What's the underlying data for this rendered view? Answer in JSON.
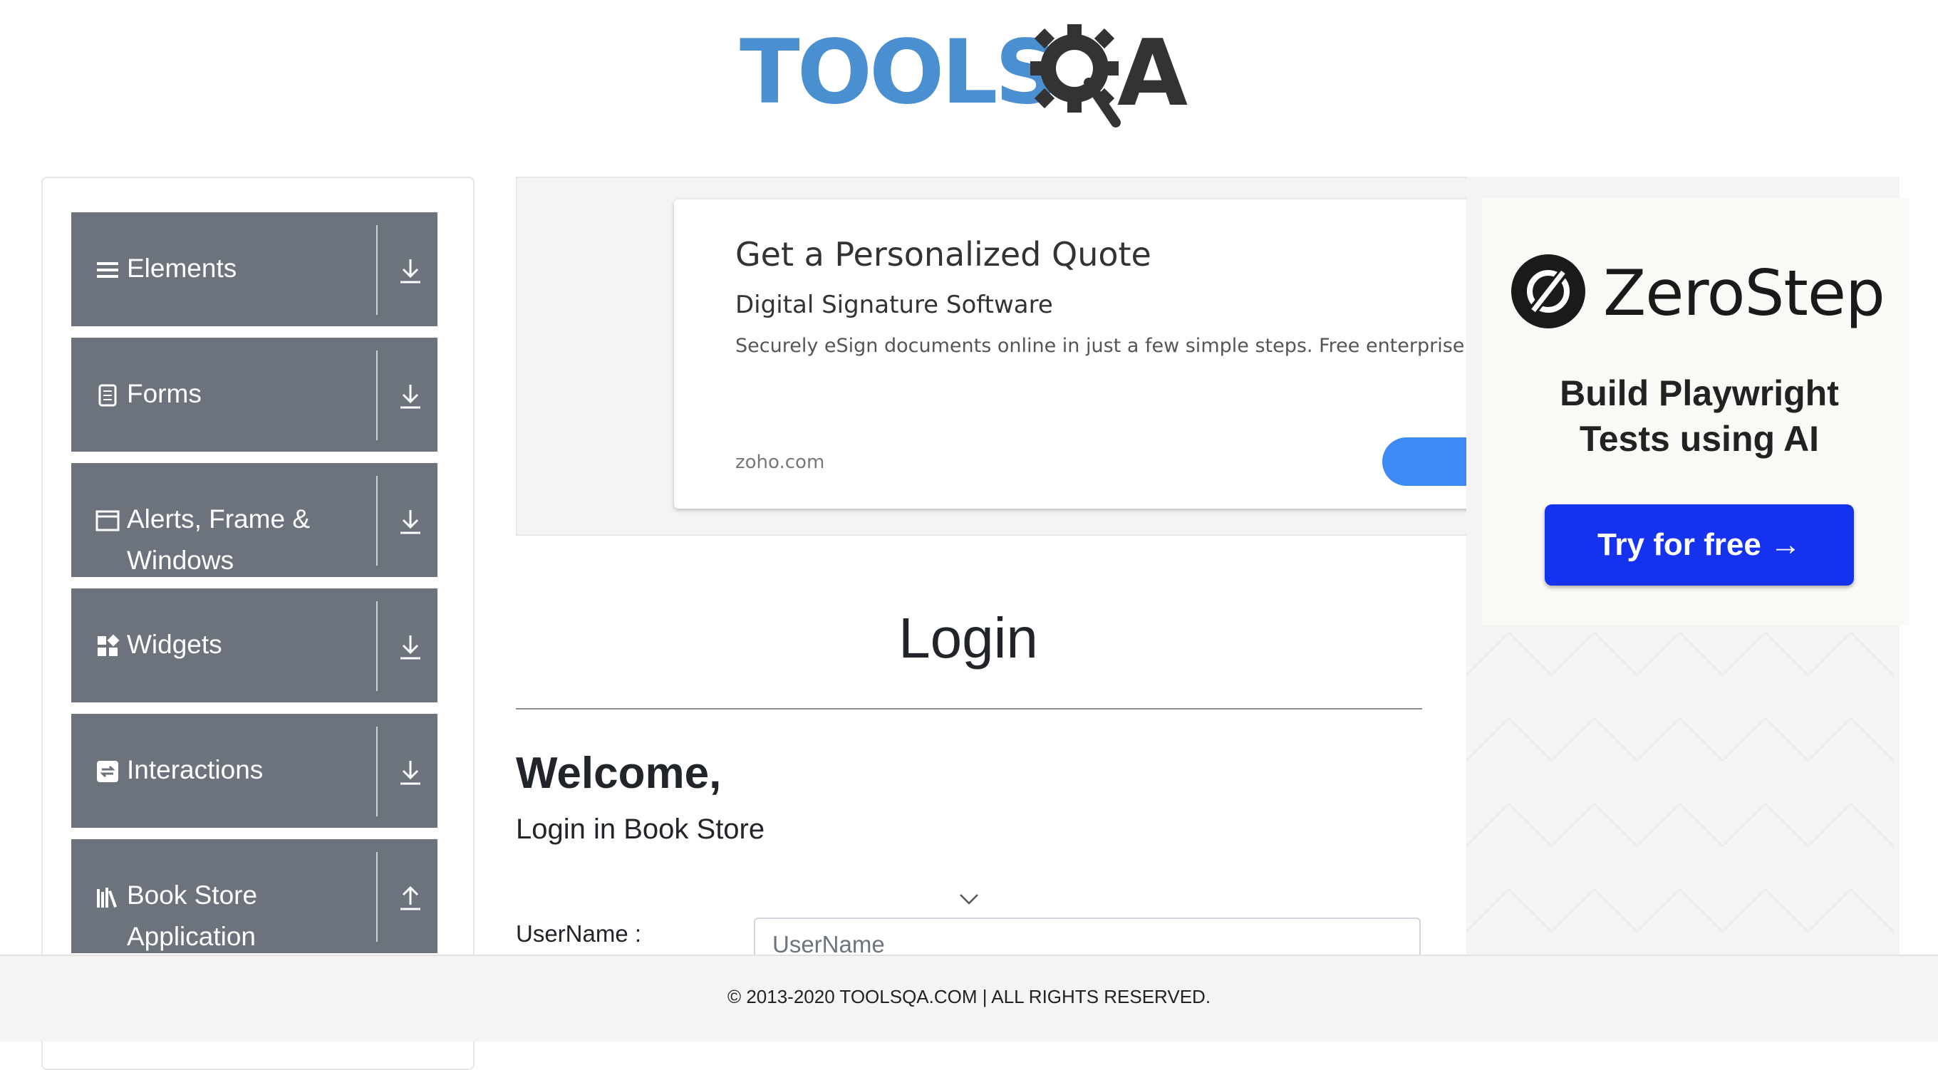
{
  "header": {
    "logo_text_left": "TOOLS",
    "logo_text_right": "A"
  },
  "sidebar": {
    "items": [
      {
        "label": "Elements",
        "icon": "hamburger-icon",
        "arrow": "download-arrow-icon"
      },
      {
        "label": "Forms",
        "icon": "document-icon",
        "arrow": "download-arrow-icon"
      },
      {
        "label": "Alerts, Frame & Windows",
        "icon": "window-icon",
        "arrow": "download-arrow-icon"
      },
      {
        "label": "Widgets",
        "icon": "widgets-icon",
        "arrow": "download-arrow-icon"
      },
      {
        "label": "Interactions",
        "icon": "interactions-icon",
        "arrow": "download-arrow-icon"
      },
      {
        "label": "Book Store Application",
        "icon": "books-icon",
        "arrow": "upload-arrow-icon"
      }
    ]
  },
  "ad": {
    "title": "Get a Personalized Quote",
    "subtitle": "Digital Signature Software",
    "body": "Securely eSign documents online in just a few simple steps. Free enterprise trial",
    "domain": "zoho.com"
  },
  "side_ad": {
    "brand": "ZeroStep",
    "headline": "Build Playwright Tests using AI",
    "button": "Try for free →",
    "button_color": "#1533ef"
  },
  "main": {
    "title": "Login",
    "welcome": "Welcome,",
    "subtitle": "Login in Book Store",
    "username_label": "UserName :",
    "username_placeholder": "UserName",
    "username_value": ""
  },
  "footer": {
    "text": "© 2013-2020 TOOLSQA.COM | ALL RIGHTS RESERVED."
  },
  "colors": {
    "sidebar_item": "#6c737c",
    "logo_blue": "#4a8fd0",
    "ad_cta": "#3d8af7"
  }
}
